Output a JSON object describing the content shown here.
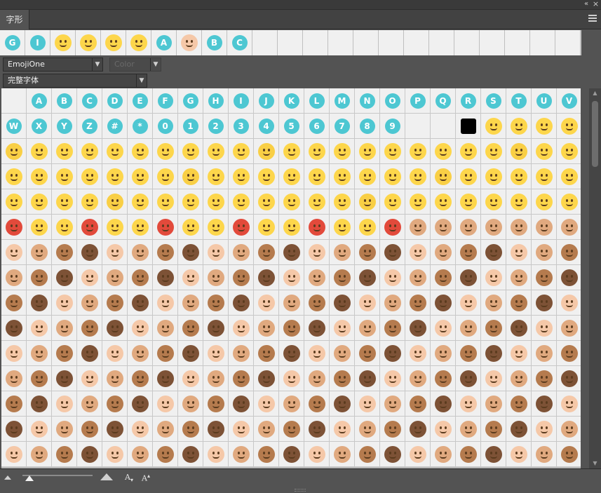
{
  "panel": {
    "tab_label": "字形",
    "collapse_icon": "double-chevron-right-icon",
    "close_icon": "close-icon",
    "menu_icon": "panel-menu-icon"
  },
  "recent": [
    {
      "kind": "letter",
      "text": "G"
    },
    {
      "kind": "letter",
      "text": "I"
    },
    {
      "kind": "face",
      "color": "#fdd64b"
    },
    {
      "kind": "face",
      "color": "#fdd64b"
    },
    {
      "kind": "face",
      "color": "#fdd64b"
    },
    {
      "kind": "face",
      "color": "#fdd64b"
    },
    {
      "kind": "letter",
      "text": "A"
    },
    {
      "kind": "face",
      "color": "#f5c8a8"
    },
    {
      "kind": "letter",
      "text": "B"
    },
    {
      "kind": "letter",
      "text": "C"
    },
    {
      "kind": "empty"
    },
    {
      "kind": "empty"
    },
    {
      "kind": "empty"
    },
    {
      "kind": "empty"
    },
    {
      "kind": "empty"
    },
    {
      "kind": "empty"
    },
    {
      "kind": "empty"
    },
    {
      "kind": "empty"
    },
    {
      "kind": "empty"
    },
    {
      "kind": "empty"
    },
    {
      "kind": "empty"
    },
    {
      "kind": "empty"
    },
    {
      "kind": "empty"
    }
  ],
  "font_family": {
    "value": "EmojiOne"
  },
  "font_style": {
    "value": "Color"
  },
  "glyph_filter": {
    "value": "完整字体"
  },
  "grid": {
    "row1": [
      "",
      "A",
      "B",
      "C",
      "D",
      "E",
      "F",
      "G",
      "H",
      "I",
      "J",
      "K",
      "L",
      "M",
      "N",
      "O",
      "P",
      "Q",
      "R",
      "S",
      "T",
      "U",
      "V"
    ],
    "row2": [
      "W",
      "X",
      "Y",
      "Z",
      "#",
      "*",
      "0",
      "1",
      "2",
      "3",
      "4",
      "5",
      "6",
      "7",
      "8",
      "9"
    ],
    "face_colors": [
      "#fdd64b",
      "#f9cf45",
      "#f5c8a8",
      "#e0a97f",
      "#b57b4e",
      "#7d5236",
      "#ffcc3d",
      "#9ee8e0",
      "#a884d8",
      "#d8d8d8",
      "#e24a3b",
      "#ff8a3d"
    ]
  },
  "colors": {
    "accent": "#4dc7d2",
    "panel_bg": "#535353",
    "cell_bg": "#f0f0f0"
  },
  "bottom": {
    "small_glyph_icon": "mountain-small-icon",
    "large_glyph_icon": "mountain-large-icon",
    "decrease_label": "A",
    "increase_label": "A"
  }
}
